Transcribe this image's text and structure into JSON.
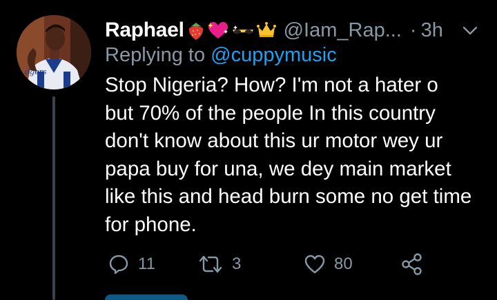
{
  "tweet": {
    "display_name": "Raphael",
    "handle": "@Iam_Rap...",
    "separator": "·",
    "timestamp": "3h",
    "replying_prefix": "Replying to ",
    "replying_to": "@cuppymusic",
    "body_lines": [
      "Stop Nigeria?  How?  I'm not a hater o",
      "but 70% of the people In this country",
      "don't know about this ur motor wey ur",
      "papa buy for una, we dey main market",
      "like this and head burn some no get time",
      "for phone."
    ],
    "name_emojis": [
      "strawberry-icon",
      "sparkling-heart-icon",
      "sunglasses-icon",
      "crown-icon"
    ]
  },
  "actions": {
    "reply_count": "11",
    "retweet_count": "3",
    "like_count": "80"
  },
  "colors": {
    "background": "#000000",
    "text_primary": "#ffffff",
    "text_secondary": "#8899a6",
    "link": "#1da1f2",
    "thread_line": "#38444d"
  }
}
